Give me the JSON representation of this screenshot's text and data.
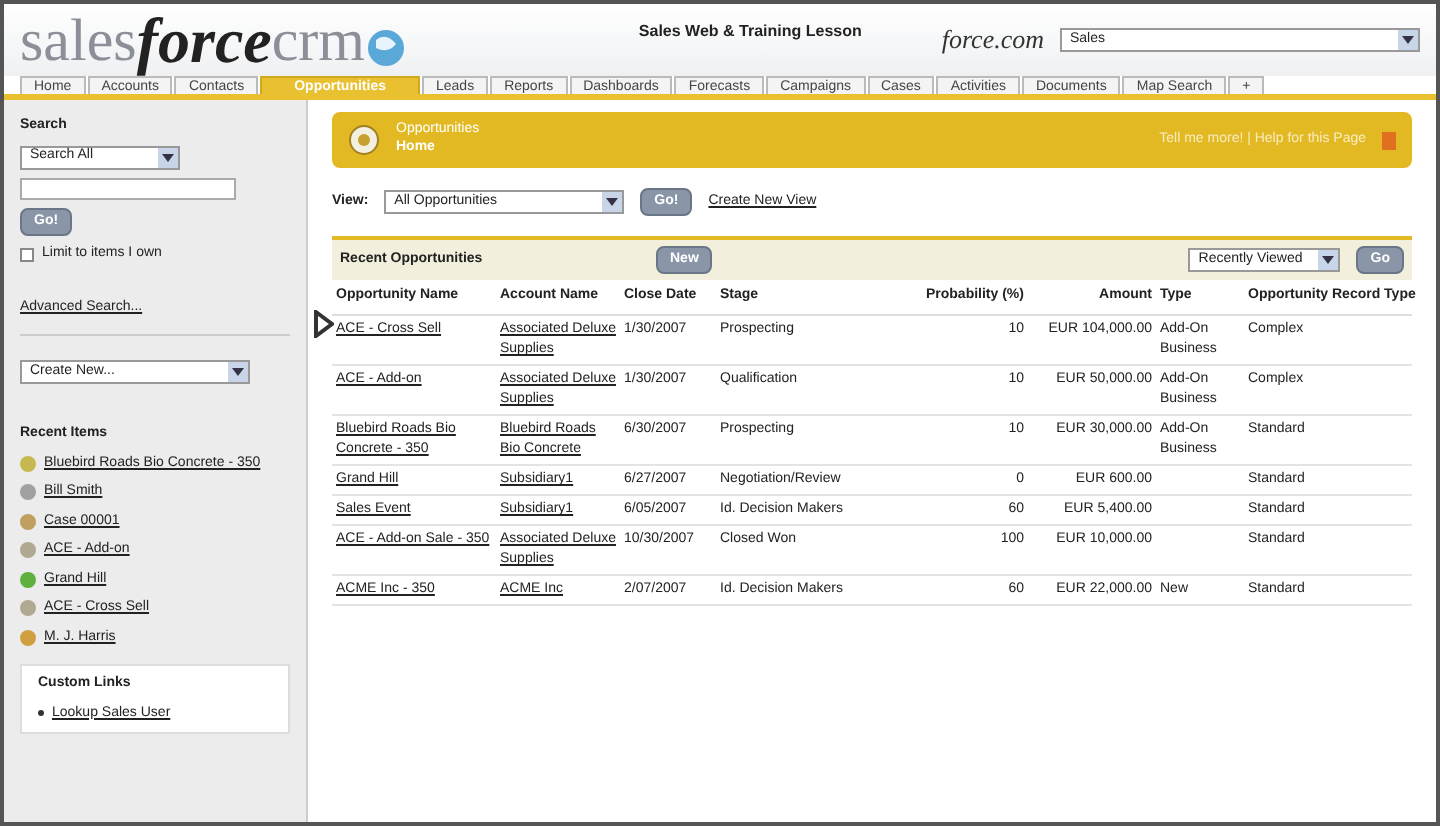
{
  "header": {
    "logo_main": "sales",
    "logo_force": "force",
    "logo_crm": "crm",
    "user_banner": "Sales Web & Training Lesson",
    "app_label": "force.com",
    "app_select": "Sales"
  },
  "tabs": [
    {
      "label": "Home",
      "selected": false
    },
    {
      "label": "Accounts",
      "selected": false
    },
    {
      "label": "Contacts",
      "selected": false
    },
    {
      "label": "Opportunities",
      "selected": true
    },
    {
      "label": "Leads",
      "selected": false
    },
    {
      "label": "Reports",
      "selected": false
    },
    {
      "label": "Dashboards",
      "selected": false
    },
    {
      "label": "Forecasts",
      "selected": false
    },
    {
      "label": "Campaigns",
      "selected": false
    },
    {
      "label": "Cases",
      "selected": false
    },
    {
      "label": "Activities",
      "selected": false
    },
    {
      "label": "Documents",
      "selected": false
    },
    {
      "label": "Map Search",
      "selected": false
    },
    {
      "label": "+",
      "selected": false
    }
  ],
  "sidebar": {
    "search_title": "Search",
    "search_scope": "Search All",
    "search_button": "Go!",
    "limit_label": "Limit to items I own",
    "limit_checked": false,
    "advanced_link": "Advanced Search...",
    "create_new": "Create New...",
    "recent_title": "Recent Items",
    "recent_items": [
      {
        "label": "Bluebird Roads Bio Concrete - 350",
        "color": "#c8b850"
      },
      {
        "label": "Bill Smith",
        "color": "#a0a0a0"
      },
      {
        "label": "Case 00001",
        "color": "#c0a060"
      },
      {
        "label": "ACE - Add-on",
        "color": "#b0a890"
      },
      {
        "label": "Grand Hill",
        "color": "#60b040"
      },
      {
        "label": "ACE - Cross Sell",
        "color": "#b0a890"
      },
      {
        "label": "M. J. Harris",
        "color": "#d0a040"
      }
    ],
    "custom_title": "Custom Links",
    "custom_links": [
      "Lookup Sales User"
    ]
  },
  "page": {
    "title": "Opportunities",
    "subtitle": "Home",
    "help": "Tell me more! | Help for this Page",
    "view_label": "View:",
    "view_select": "All Opportunities",
    "view_button": "Go!",
    "create_view": "Create New View",
    "recent_title": "Recent Opportunities",
    "new_button": "New",
    "recent_select": "Recently Viewed",
    "recent_button": "Go"
  },
  "table": {
    "columns": [
      "Opportunity Name",
      "Account Name",
      "Close Date",
      "Stage",
      "Probability (%)",
      "Amount",
      "Type",
      "Opportunity Record Type"
    ],
    "rows": [
      [
        "ACE - Cross Sell",
        "Associated Deluxe Supplies",
        "1/30/2007",
        "Prospecting",
        "10",
        "EUR 104,000.00",
        "Add-On Business",
        "Complex"
      ],
      [
        "ACE - Add-on",
        "Associated Deluxe Supplies",
        "1/30/2007",
        "Qualification",
        "10",
        "EUR 50,000.00",
        "Add-On Business",
        "Complex"
      ],
      [
        "Bluebird Roads Bio Concrete - 350",
        "Bluebird Roads Bio Concrete",
        "6/30/2007",
        "Prospecting",
        "10",
        "EUR 30,000.00",
        "Add-On Business",
        "Standard"
      ],
      [
        "Grand Hill",
        "Subsidiary1",
        "6/27/2007",
        "Negotiation/Review",
        "0",
        "EUR 600.00",
        "",
        "Standard"
      ],
      [
        "Sales Event",
        "Subsidiary1",
        "6/05/2007",
        "Id. Decision Makers",
        "60",
        "EUR 5,400.00",
        "",
        "Standard"
      ],
      [
        "ACE - Add-on Sale - 350",
        "Associated Deluxe Supplies",
        "10/30/2007",
        "Closed Won",
        "100",
        "EUR 10,000.00",
        "",
        "Standard"
      ],
      [
        "ACME Inc - 350",
        "ACME Inc",
        "2/07/2007",
        "Id. Decision Makers",
        "60",
        "EUR 22,000.00",
        "New",
        "Standard"
      ]
    ]
  }
}
